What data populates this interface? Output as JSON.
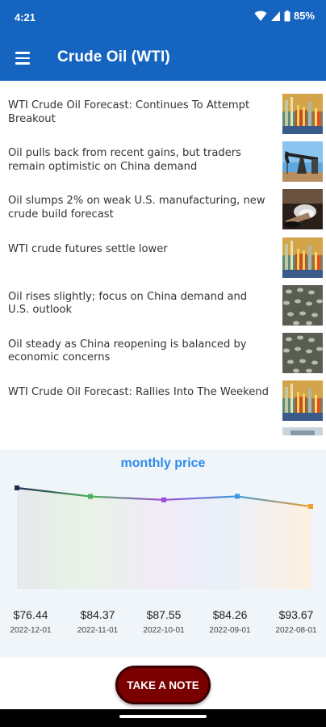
{
  "status_bar": {
    "time": "4:21",
    "battery": "85%"
  },
  "app_bar": {
    "title": "Crude Oil (WTI)",
    "menu_icon": "hamburger-menu-icon"
  },
  "news": [
    {
      "title": "WTI Crude Oil Forecast: Continues To Attempt Breakout",
      "thumb": "refinery-sunset"
    },
    {
      "title": "Oil pulls back from recent gains, but traders remain optimistic on China demand",
      "thumb": "pumpjack"
    },
    {
      "title": "Oil slumps 2% on weak U.S. manufacturing, new crude build forecast",
      "thumb": "oil-pipe-spill"
    },
    {
      "title": "WTI crude futures settle lower",
      "thumb": "refinery-sunset"
    },
    {
      "title": "Oil rises slightly; focus on China demand and U.S. outlook",
      "thumb": "storage-tanks"
    },
    {
      "title": "Oil steady as China reopening is balanced by economic concerns",
      "thumb": "storage-tanks"
    },
    {
      "title": "WTI Crude Oil Forecast: Rallies Into The Weekend",
      "thumb": "refinery-sunset"
    }
  ],
  "chart": {
    "title": "monthly price"
  },
  "chart_data": {
    "type": "line",
    "x": [
      "2022-12-01",
      "2022-11-01",
      "2022-10-01",
      "2022-09-01",
      "2022-08-01"
    ],
    "values": [
      76.44,
      84.37,
      87.55,
      84.26,
      93.67
    ],
    "labels": [
      "$76.44",
      "$84.37",
      "$87.55",
      "$84.26",
      "$93.67"
    ],
    "colors": [
      "#1E2A55",
      "#4CB05A",
      "#A04AD8",
      "#3D9BE0",
      "#F0A02A"
    ]
  },
  "take_note": {
    "label": "TAKE A NOTE"
  }
}
